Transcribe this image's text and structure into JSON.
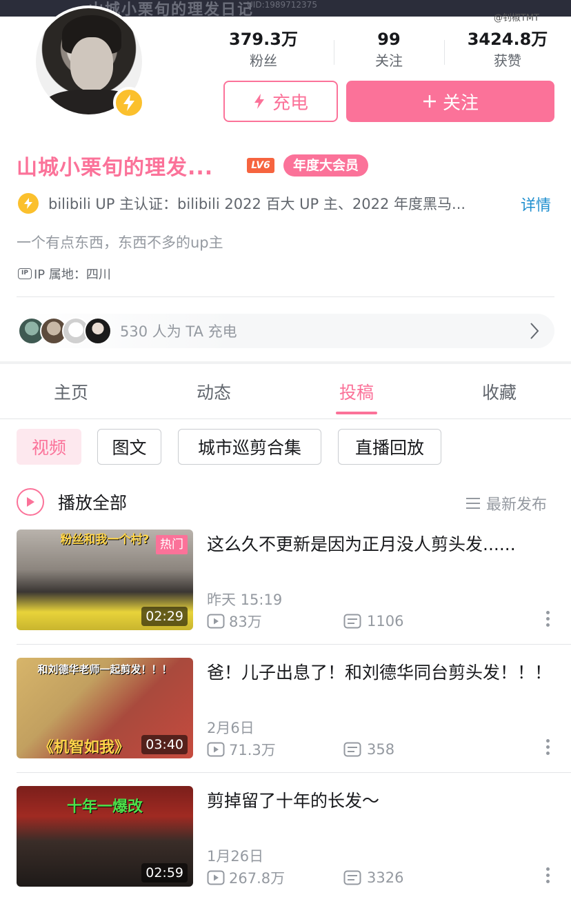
{
  "banner": {
    "text": "山城小栗旬的理发日记",
    "uid": "UID:1989712375"
  },
  "watermark": "@钊椒TMT",
  "stats": [
    {
      "value": "379.3万",
      "label": "粉丝"
    },
    {
      "value": "99",
      "label": "关注"
    },
    {
      "value": "3424.8万",
      "label": "获赞"
    }
  ],
  "actions": {
    "charge_label": "充电",
    "follow_label": "关注"
  },
  "profile": {
    "name": "山城小栗旬的理发...",
    "level_badge": "LV6",
    "vip_badge": "年度大会员",
    "certification": "bilibili UP 主认证：bilibili 2022 百大 UP 主、2022 年度黑马...",
    "detail_link": "详情",
    "signature": "一个有点东西，东西不多的up主",
    "ip_icon_text": "IP",
    "ip_location": "IP 属地：四川"
  },
  "charge_bar": {
    "text": "530 人为 TA 充电",
    "supporter_count": 530
  },
  "tabs": [
    {
      "label": "主页",
      "active": false
    },
    {
      "label": "动态",
      "active": false
    },
    {
      "label": "投稿",
      "active": true
    },
    {
      "label": "收藏",
      "active": false
    }
  ],
  "filters": [
    {
      "label": "视频",
      "active": true
    },
    {
      "label": "图文",
      "active": false
    },
    {
      "label": "城市巡剪合集",
      "active": false
    },
    {
      "label": "直播回放",
      "active": false
    }
  ],
  "list_header": {
    "play_all": "播放全部",
    "sort": "最新发布"
  },
  "videos": [
    {
      "title": "这么久不更新是因为正月没人剪头发......",
      "thumb_caption": "粉丝和我一个村?",
      "badge": "热门",
      "duration": "02:29",
      "date": "昨天 15:19",
      "views": "83万",
      "danmaku": "1106"
    },
    {
      "title": "爸！儿子出息了！和刘德华同台剪头发！！！",
      "thumb_caption": "和刘德华老师一起剪发！！！",
      "thumb_caption_2": "《机智如我》",
      "badge": "",
      "duration": "03:40",
      "date": "2月6日",
      "views": "71.3万",
      "danmaku": "358"
    },
    {
      "title": "剪掉留了十年的长发～",
      "thumb_caption": "十年一爆改",
      "badge": "",
      "duration": "02:59",
      "date": "1月26日",
      "views": "267.8万",
      "danmaku": "3326"
    }
  ],
  "colors": {
    "accent": "#fb7299",
    "link": "#1f8fcf",
    "gold": "#fbc02d",
    "muted": "#9499a0"
  }
}
